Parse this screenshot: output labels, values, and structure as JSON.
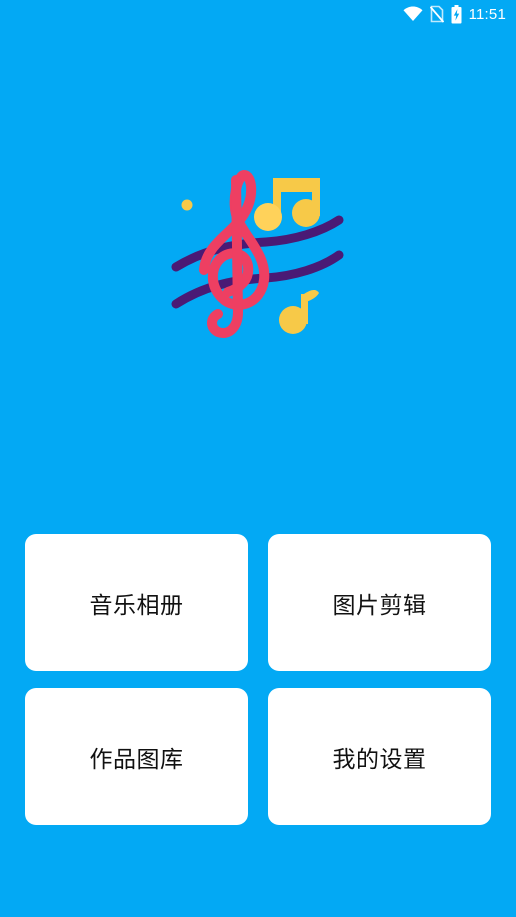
{
  "status_bar": {
    "time": "11:51",
    "icons": [
      "wifi-icon",
      "no-sim-icon",
      "battery-charging-icon"
    ]
  },
  "app": {
    "logo_icon": "music-notes-treble-clef-icon",
    "background_color": "#03a9f4"
  },
  "menu": {
    "items": [
      {
        "label": "音乐相册"
      },
      {
        "label": "图片剪辑"
      },
      {
        "label": "作品图库"
      },
      {
        "label": "我的设置"
      }
    ]
  }
}
